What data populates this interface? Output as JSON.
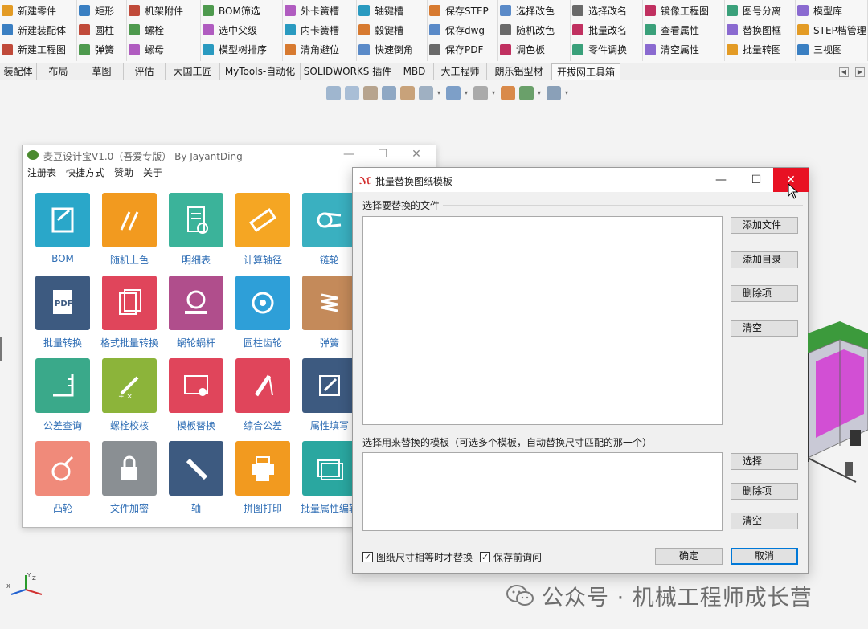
{
  "ribbon": {
    "columns": [
      {
        "items": [
          "新建零件",
          "新建装配体",
          "新建工程图"
        ]
      },
      {
        "items": [
          "矩形",
          "圆柱",
          "弹簧"
        ]
      },
      {
        "items": [
          "机架附件",
          "螺栓",
          "螺母"
        ]
      },
      {
        "items": [
          "BOM筛选",
          "选中父级",
          "模型树排序"
        ]
      },
      {
        "items": [
          "外卡簧槽",
          "内卡簧槽",
          "清角避位"
        ]
      },
      {
        "items": [
          "轴键槽",
          "毂键槽",
          "快速倒角"
        ]
      },
      {
        "items": [
          "保存STEP",
          "保存dwg",
          "保存PDF"
        ]
      },
      {
        "items": [
          "选择改色",
          "随机改色",
          "调色板"
        ]
      },
      {
        "items": [
          "选择改名",
          "批量改名",
          "零件调换"
        ]
      },
      {
        "items": [
          "镜像工程图",
          "查看属性",
          "清空属性"
        ]
      },
      {
        "items": [
          "图号分离",
          "替换图框",
          "批量转图"
        ]
      },
      {
        "items": [
          "模型库",
          "STEP档管理",
          "三视图"
        ]
      }
    ],
    "tabs": [
      "装配体",
      "布局",
      "草图",
      "评估",
      "大国工匠",
      "MyTools-自动化",
      "SOLIDWORKS 插件",
      "MBD",
      "大工程师",
      "朗乐铝型材",
      "开拔网工具箱"
    ]
  },
  "app": {
    "title": "麦豆设计宝V1.0（吾爱专版） By JayantDing",
    "menu": [
      "注册表",
      "快捷方式",
      "赞助",
      "关于"
    ],
    "tiles": [
      {
        "label": "BOM",
        "color": "#2aa7c9"
      },
      {
        "label": "随机上色",
        "color": "#f29a1f"
      },
      {
        "label": "明细表",
        "color": "#3bb39a"
      },
      {
        "label": "计算轴径",
        "color": "#f5a623"
      },
      {
        "label": "链轮",
        "color": "#3ab0c0"
      },
      {
        "label": "批量转换",
        "color": "#3d5a80"
      },
      {
        "label": "格式批量转换",
        "color": "#e0455b"
      },
      {
        "label": "蜗轮蜗杆",
        "color": "#b04e8c"
      },
      {
        "label": "圆柱齿轮",
        "color": "#2e9fd8"
      },
      {
        "label": "弹簧",
        "color": "#c48a5a"
      },
      {
        "label": "公差查询",
        "color": "#3aa98a"
      },
      {
        "label": "螺栓校核",
        "color": "#8cb43a"
      },
      {
        "label": "模板替换",
        "color": "#e0455b"
      },
      {
        "label": "综合公差",
        "color": "#e0455b"
      },
      {
        "label": "属性填写",
        "color": "#3d5a80"
      },
      {
        "label": "凸轮",
        "color": "#f08a7a"
      },
      {
        "label": "文件加密",
        "color": "#8a8f93"
      },
      {
        "label": "轴",
        "color": "#3d5a80"
      },
      {
        "label": "拼图打印",
        "color": "#f29a1f"
      },
      {
        "label": "批量属性编辑",
        "color": "#2aa7a0"
      }
    ]
  },
  "dialog": {
    "title": "批量替换图纸模板",
    "group1_label": "选择要替换的文件",
    "group2_label": "选择用来替换的模板（可选多个模板，自动替换尺寸匹配的那一个）",
    "buttons1": [
      "添加文件",
      "添加目录",
      "删除项",
      "清空"
    ],
    "buttons2": [
      "选择",
      "删除项",
      "清空"
    ],
    "check1": "图纸尺寸相等时才替换",
    "check2": "保存前询问",
    "ok": "确定",
    "cancel": "取消"
  },
  "watermark": "公众号 · 机械工程师成长营"
}
